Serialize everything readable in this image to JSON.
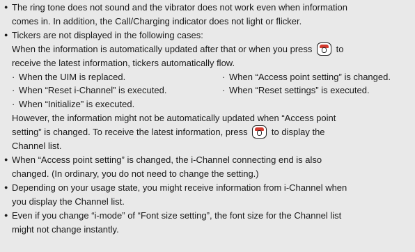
{
  "bullet_glyph": "●",
  "case_mark": "·",
  "icon": "power-end-key-icon",
  "items": [
    {
      "lines": [
        "The ring tone does not sound and the vibrator does not work even when information",
        "comes in. In addition, the Call/Charging indicator does not light or flicker."
      ]
    },
    {
      "title": "Tickers are not displayed in the following cases:",
      "line1_before": "When the information is automatically updated after that or when you press",
      "line1_after": "to",
      "line2": "receive the latest information, tickers automatically flow.",
      "cases": [
        "When the UIM is replaced.",
        "When “Access point setting” is changed.",
        "When “Reset i-Channel” is executed.",
        "When “Reset settings” is executed.",
        "When “Initialize” is executed."
      ],
      "note_line1": "However, the information might not be automatically updated when “Access point",
      "note_line2_before": "setting” is changed. To receive the latest information, press",
      "note_line2_after": "to display the",
      "note_line3": "Channel list."
    },
    {
      "lines": [
        "When “Access point setting” is changed, the i-Channel connecting end is also",
        "changed. (In ordinary, you do not need to change the setting.)"
      ]
    },
    {
      "lines": [
        "Depending on your usage state, you might receive information from i-Channel when",
        "you display the Channel list."
      ]
    },
    {
      "lines": [
        "Even if you change “i-mode” of “Font size setting”, the font size for the Channel list",
        "might not change instantly."
      ]
    }
  ]
}
